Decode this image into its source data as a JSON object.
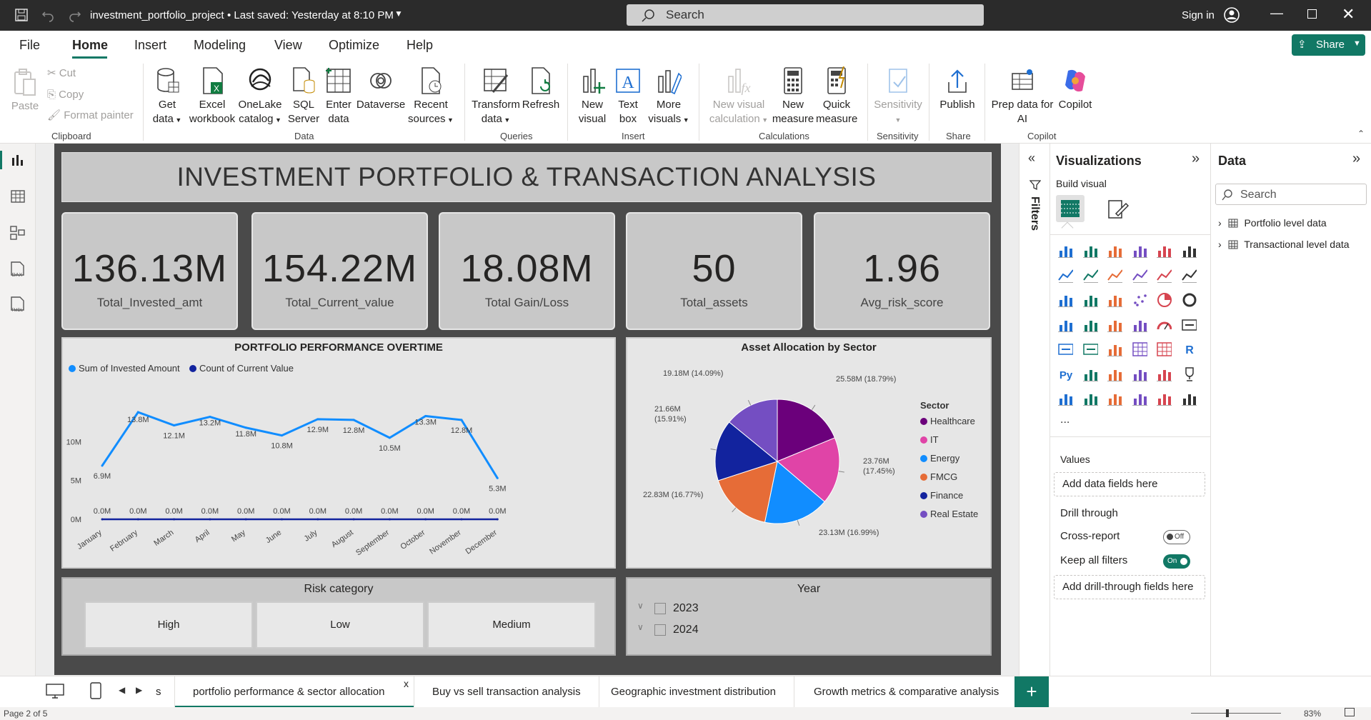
{
  "app": {
    "file_title": "investment_portfolio_project",
    "saved": "• Last saved: Yesterday at 8:10 PM",
    "search": "Search",
    "sign_in": "Sign in",
    "share": "Share"
  },
  "menu": [
    "File",
    "Home",
    "Insert",
    "Modeling",
    "View",
    "Optimize",
    "Help"
  ],
  "ribbon": {
    "clipboard": {
      "paste": "Paste",
      "cut": "Cut",
      "copy": "Copy",
      "format_painter": "Format painter",
      "group": "Clipboard"
    },
    "data": {
      "get_data": [
        "Get",
        "data"
      ],
      "excel": [
        "Excel",
        "workbook"
      ],
      "onelake": [
        "OneLake",
        "catalog"
      ],
      "sql": [
        "SQL",
        "Server"
      ],
      "enter": [
        "Enter",
        "data"
      ],
      "dataverse": "Dataverse",
      "recent": [
        "Recent",
        "sources"
      ],
      "group": "Data"
    },
    "queries": {
      "transform": [
        "Transform",
        "data"
      ],
      "refresh": "Refresh",
      "group": "Queries"
    },
    "insert": {
      "new_visual": [
        "New",
        "visual"
      ],
      "text_box": [
        "Text",
        "box"
      ],
      "more_visuals": [
        "More",
        "visuals"
      ],
      "group": "Insert"
    },
    "calculations": {
      "new_visual_calc": [
        "New visual",
        "calculation"
      ],
      "new_measure": [
        "New",
        "measure"
      ],
      "quick_measure": [
        "Quick",
        "measure"
      ],
      "group": "Calculations"
    },
    "sensitivity": {
      "label": "Sensitivity",
      "group": "Sensitivity"
    },
    "share": {
      "publish": "Publish",
      "group": "Share"
    },
    "copilot": {
      "prep": [
        "Prep data for",
        "AI"
      ],
      "copilot": "Copilot",
      "group": "Copilot"
    }
  },
  "report": {
    "title": "INVESTMENT PORTFOLIO & TRANSACTION ANALYSIS",
    "kpis": [
      {
        "value": "136.13M",
        "label": "Total_Invested_amt"
      },
      {
        "value": "154.22M",
        "label": "Total_Current_value"
      },
      {
        "value": "18.08M",
        "label": "Total Gain/Loss"
      },
      {
        "value": "50",
        "label": "Total_assets"
      },
      {
        "value": "1.96",
        "label": "Avg_risk_score"
      }
    ],
    "risk_slicer": {
      "title": "Risk category",
      "options": [
        "High",
        "Low",
        "Medium"
      ]
    },
    "year_slicer": {
      "title": "Year",
      "options": [
        "2023",
        "2024"
      ]
    }
  },
  "chart_data": [
    {
      "type": "line",
      "title": "PORTFOLIO PERFORMANCE OVERTIME",
      "categories": [
        "January",
        "February",
        "March",
        "April",
        "May",
        "June",
        "July",
        "August",
        "September",
        "October",
        "November",
        "December"
      ],
      "series": [
        {
          "name": "Sum of Invested Amount",
          "color": "#118dff",
          "values": [
            6.9,
            13.8,
            12.1,
            13.2,
            11.8,
            10.8,
            12.9,
            12.8,
            10.5,
            13.3,
            12.8,
            5.3
          ],
          "labels": [
            "6.9M",
            "13.8M",
            "12.1M",
            "13.2M",
            "11.8M",
            "10.8M",
            "12.9M",
            "12.8M",
            "10.5M",
            "13.3M",
            "12.8M",
            "5.3M"
          ]
        },
        {
          "name": "Count of Current Value",
          "color": "#12239e",
          "values": [
            0,
            0,
            0,
            0,
            0,
            0,
            0,
            0,
            0,
            0,
            0,
            0
          ],
          "labels": [
            "0.0M",
            "0.0M",
            "0.0M",
            "0.0M",
            "0.0M",
            "0.0M",
            "0.0M",
            "0.0M",
            "0.0M",
            "0.0M",
            "0.0M",
            "0.0M"
          ]
        }
      ],
      "yticks": [
        "0M",
        "5M",
        "10M"
      ],
      "ylim": [
        0,
        15
      ],
      "legend": "top-left"
    },
    {
      "type": "pie",
      "title": "Asset Allocation by Sector",
      "legend_title": "Sector",
      "slices": [
        {
          "name": "Healthcare",
          "value": 25.58,
          "label": "25.58M (18.79%)",
          "color": "#6b007b"
        },
        {
          "name": "IT",
          "value": 23.76,
          "label": "23.76M (17.45%)",
          "color": "#e044a7"
        },
        {
          "name": "Energy",
          "value": 23.13,
          "label": "23.13M (16.99%)",
          "color": "#118dff"
        },
        {
          "name": "FMCG",
          "value": 22.83,
          "label": "22.83M (16.77%)",
          "color": "#e66c37"
        },
        {
          "name": "Finance",
          "value": 21.66,
          "label": "21.66M (15.91%)",
          "color": "#12239e"
        },
        {
          "name": "Real Estate",
          "value": 19.18,
          "label": "19.18M (14.09%)",
          "color": "#744ec2"
        }
      ],
      "legend": "right"
    }
  ],
  "filters_label": "Filters",
  "viz": {
    "title": "Visualizations",
    "build": "Build visual",
    "values": "Values",
    "add_data": "Add data fields here",
    "drill": "Drill through",
    "cross": "Cross-report",
    "cross_state": "Off",
    "keep": "Keep all filters",
    "keep_state": "On",
    "add_drill": "Add drill-through fields here",
    "more": "..."
  },
  "data_pane": {
    "title": "Data",
    "search": "Search",
    "tables": [
      "Portfolio level data",
      "Transactional level data"
    ]
  },
  "tabs": {
    "partial": "s",
    "active": "portfolio performance & sector allocation",
    "others": [
      "Buy vs sell transaction analysis",
      "Geographic investment distribution",
      "Growth metrics & comparative analysis"
    ]
  },
  "status": {
    "page": "Page 2 of 5",
    "zoom": "83%"
  }
}
